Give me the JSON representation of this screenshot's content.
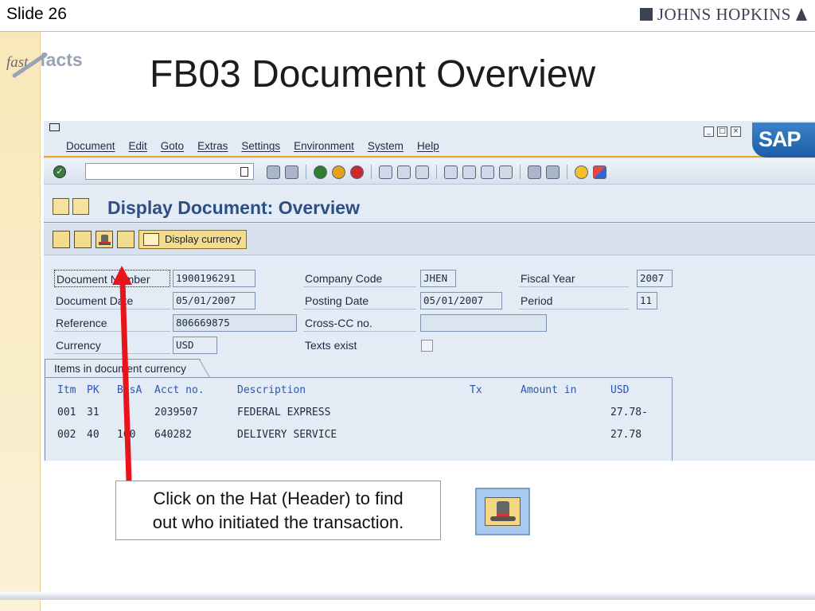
{
  "slide": {
    "number_label": "Slide 26",
    "logo_text": "JOHNS HOPKINS",
    "brand_fast": "fast",
    "brand_facts": "facts",
    "title": "FB03 Document Overview"
  },
  "sap": {
    "menu": [
      "Document",
      "Edit",
      "Goto",
      "Extras",
      "Settings",
      "Environment",
      "System",
      "Help"
    ],
    "logo": "SAP",
    "screen_title": "Display Document: Overview",
    "display_currency_label": "Display currency",
    "header": {
      "document_number_label": "Document Number",
      "document_number": "1900196291",
      "company_code_label": "Company Code",
      "company_code": "JHEN",
      "fiscal_year_label": "Fiscal Year",
      "fiscal_year": "2007",
      "document_date_label": "Document Date",
      "document_date": "05/01/2007",
      "posting_date_label": "Posting Date",
      "posting_date": "05/01/2007",
      "period_label": "Period",
      "period": "11",
      "reference_label": "Reference",
      "reference": "806669875",
      "cross_cc_label": "Cross-CC no.",
      "cross_cc": "",
      "currency_label": "Currency",
      "currency": "USD",
      "texts_exist_label": "Texts exist",
      "texts_exist": false
    },
    "items_tab_label": "Items in document currency",
    "items_columns": {
      "itm": "Itm",
      "pk": "PK",
      "busa": "BusA",
      "acct": "Acct no.",
      "desc": "Description",
      "tx": "Tx",
      "amount": "Amount in",
      "currency": "USD"
    },
    "items": [
      {
        "itm": "001",
        "pk": "31",
        "busa": "",
        "acct": "2039507",
        "desc": "FEDERAL EXPRESS",
        "tx": "",
        "amount": "27.78-"
      },
      {
        "itm": "002",
        "pk": "40",
        "busa": "100",
        "acct": "640282",
        "desc": "DELIVERY SERVICE",
        "tx": "",
        "amount": "27.78"
      }
    ]
  },
  "callout": {
    "line1": "Click on the Hat (Header) to find",
    "line2": "out who initiated the transaction."
  },
  "colors": {
    "arrow": "#e8141c",
    "sap_title": "#2c4f86",
    "sap_bg": "#e3ebf4",
    "accent_orange": "#f0a020"
  }
}
